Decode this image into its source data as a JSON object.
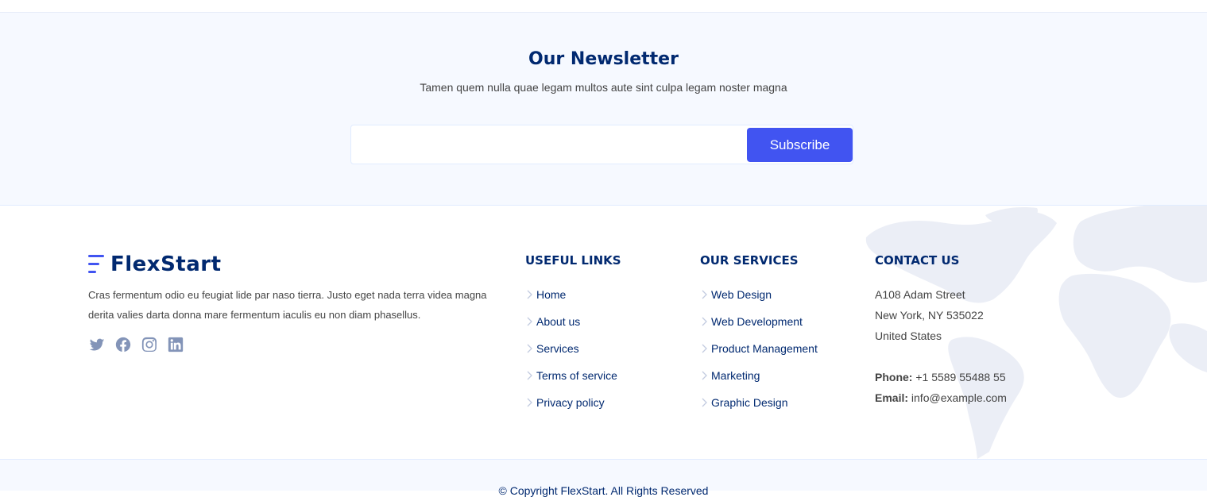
{
  "newsletter": {
    "title": "Our Newsletter",
    "subtitle": "Tamen quem nulla quae legam multos aute sint culpa legam noster magna",
    "input_value": "",
    "subscribe_label": "Subscribe"
  },
  "footer": {
    "brand": "FlexStart",
    "about": "Cras fermentum odio eu feugiat lide par naso tierra. Justo eget nada terra videa magna derita valies darta donna mare fermentum iaculis eu non diam phasellus.",
    "social_icons": [
      "twitter-icon",
      "facebook-icon",
      "instagram-icon",
      "linkedin-icon"
    ],
    "useful_links": {
      "heading": "USEFUL LINKS",
      "items": [
        "Home",
        "About us",
        "Services",
        "Terms of service",
        "Privacy policy"
      ]
    },
    "services": {
      "heading": "OUR SERVICES",
      "items": [
        "Web Design",
        "Web Development",
        "Product Management",
        "Marketing",
        "Graphic Design"
      ]
    },
    "contact": {
      "heading": "CONTACT US",
      "address1": "A108 Adam Street",
      "address2": "New York, NY 535022",
      "address3": "United States",
      "phone_label": "Phone:",
      "phone": "+1 5589 55488 55",
      "email_label": "Email:",
      "email": "info@example.com"
    },
    "copyright": "© Copyright FlexStart. All Rights Reserved"
  },
  "colors": {
    "primary": "#4154f1",
    "heading": "#012970",
    "text": "#444444",
    "light_bg": "#f6f9ff",
    "social_icon": "#8394b8"
  }
}
